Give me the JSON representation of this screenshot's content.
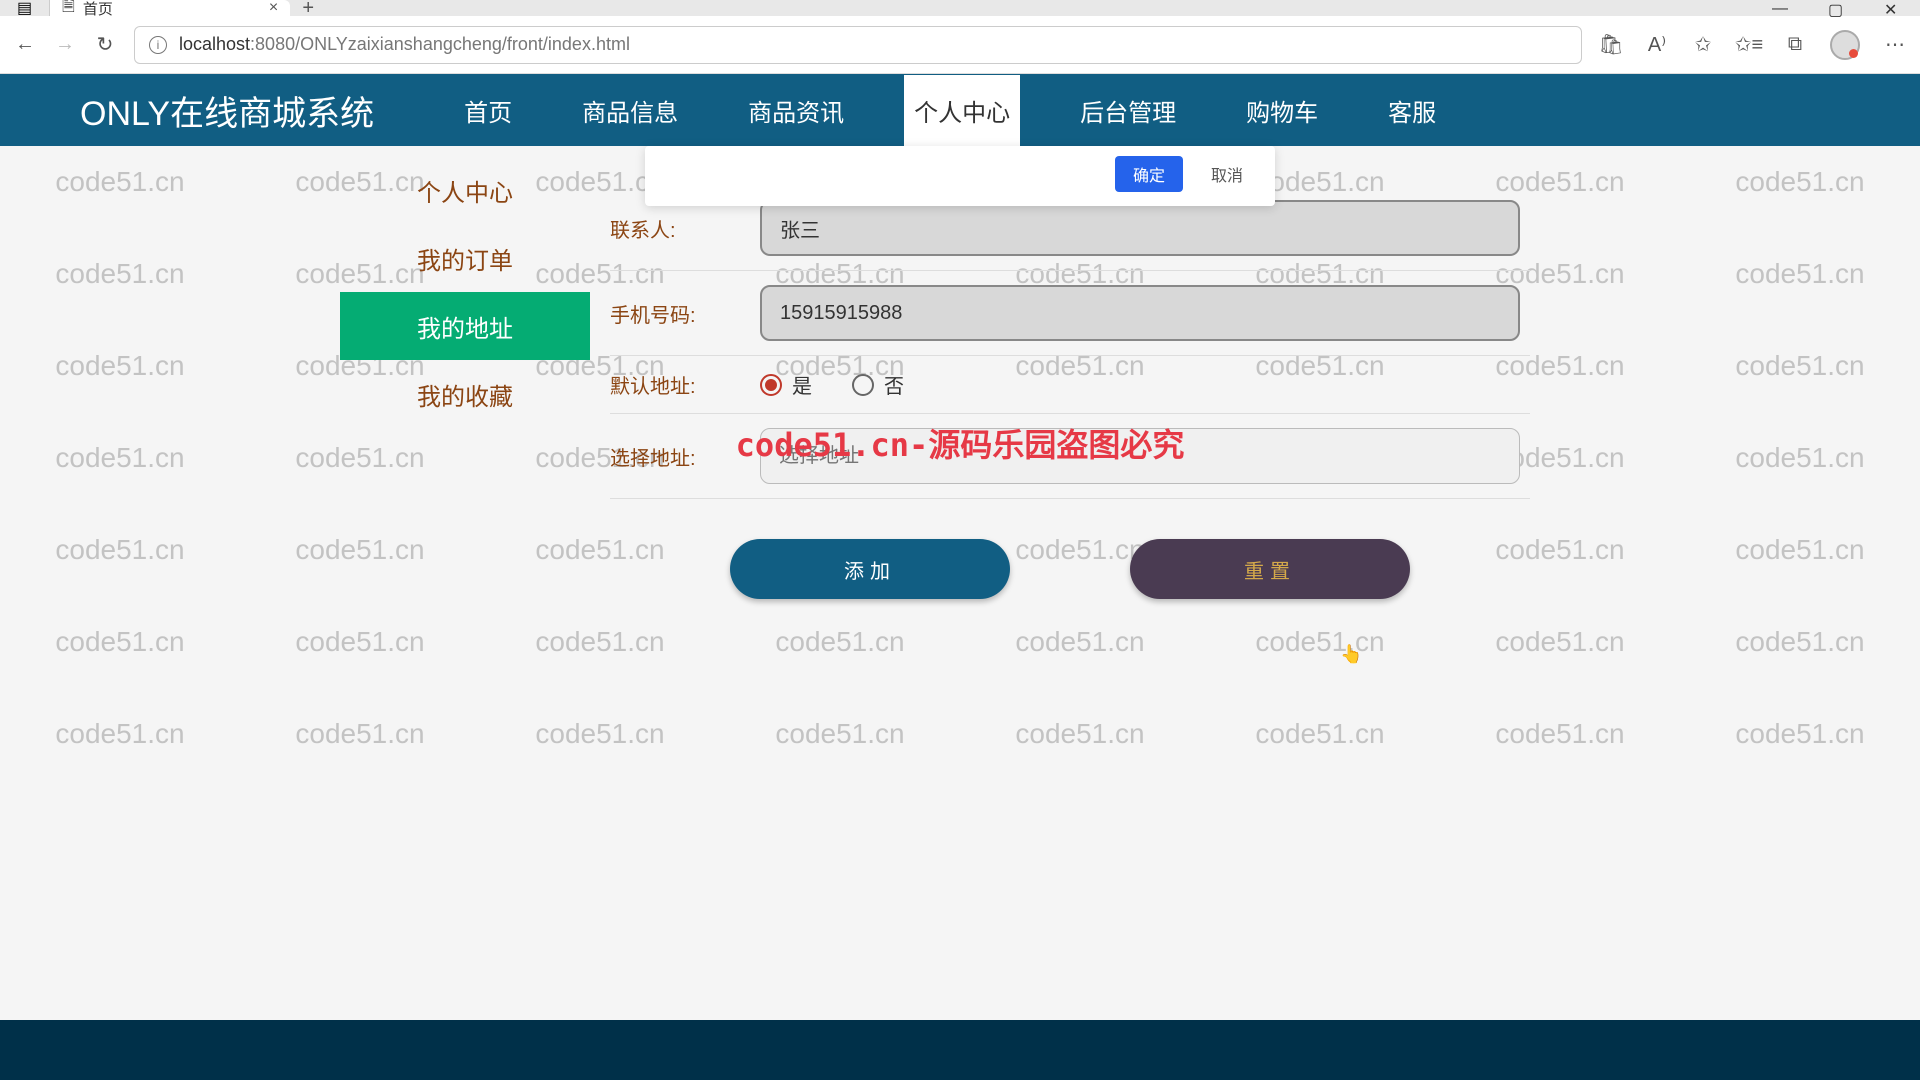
{
  "browser": {
    "tab_title": "首页",
    "url_host": "localhost",
    "url_port": ":8080",
    "url_path": "/ONLYzaixianshangcheng/front/index.html"
  },
  "header": {
    "logo": "ONLY在线商城系统",
    "nav": [
      "首页",
      "商品信息",
      "商品资讯",
      "个人中心",
      "后台管理",
      "购物车",
      "客服"
    ],
    "active_index": 3
  },
  "sidebar": {
    "items": [
      "个人中心",
      "我的订单",
      "我的地址",
      "我的收藏"
    ],
    "active_index": 2
  },
  "dialog": {
    "confirm": "确定",
    "cancel": "取消"
  },
  "form": {
    "contact_label": "联系人:",
    "contact_value": "张三",
    "phone_label": "手机号码:",
    "phone_value": "15915915988",
    "default_label": "默认地址:",
    "radio_yes": "是",
    "radio_no": "否",
    "radio_selected": "yes",
    "select_label": "选择地址:",
    "select_placeholder": "选择地址",
    "btn_add": "添加",
    "btn_reset": "重置"
  },
  "watermark": {
    "text": "code51.cn",
    "red_text": "code51.cn-源码乐园盗图必究"
  }
}
